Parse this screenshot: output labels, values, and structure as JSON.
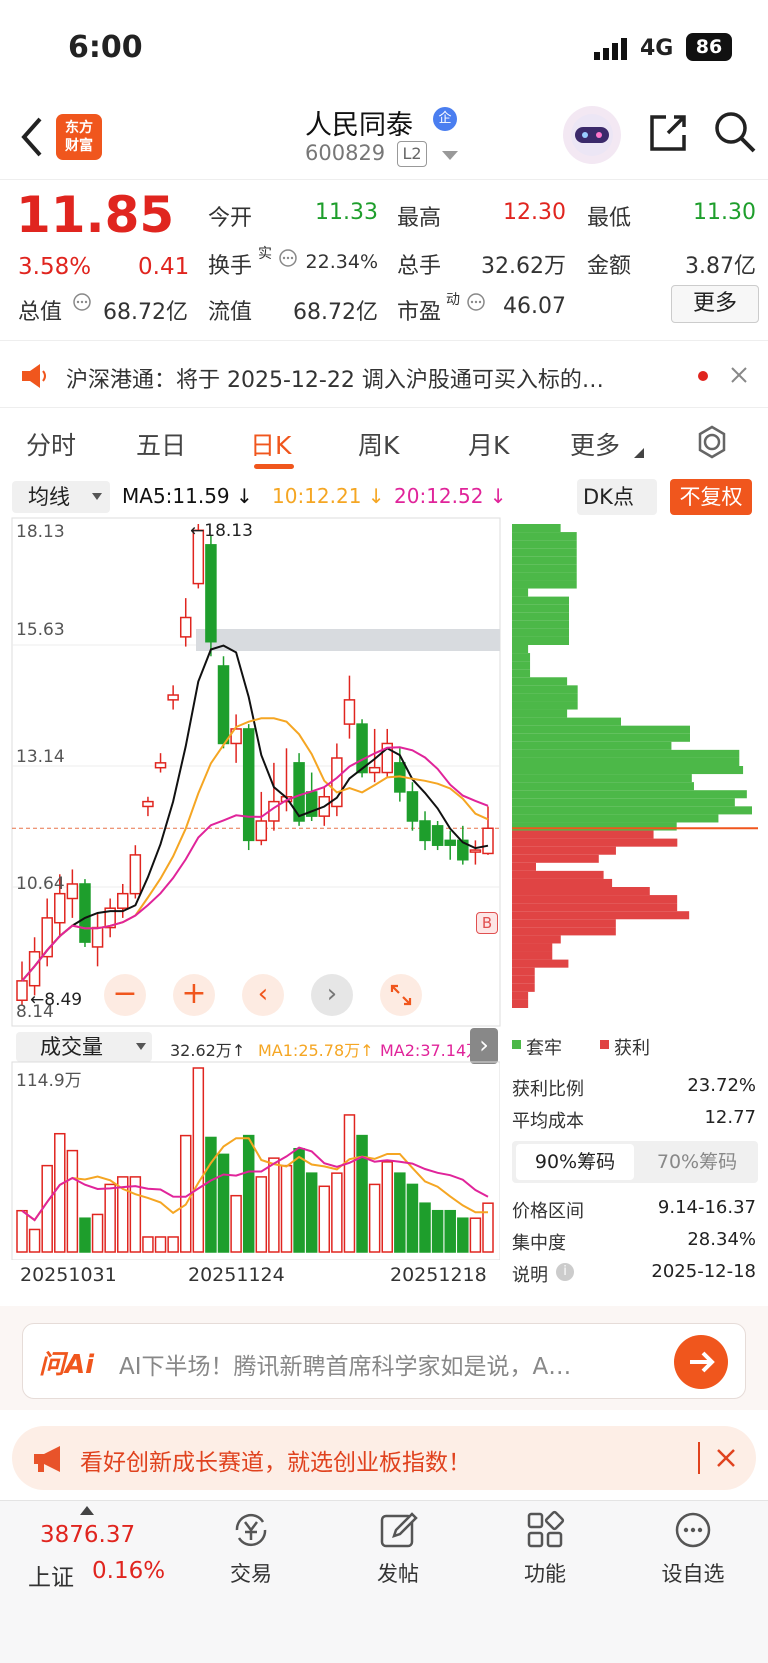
{
  "status_bar": {
    "time": "6:00",
    "network": "4G",
    "battery": "86"
  },
  "header": {
    "logo_text": "东方\n财富",
    "stock_name": "人民同泰",
    "badge": "企",
    "code": "600829",
    "level": "L2"
  },
  "quote": {
    "price": "11.85",
    "change_pct": "3.58%",
    "change_amt": "0.41",
    "open_label": "今开",
    "open": "11.33",
    "high_label": "最高",
    "high": "12.30",
    "low_label": "最低",
    "low": "11.30",
    "turnover_label": "换手",
    "turnover_sup": "实",
    "turnover": "22.34%",
    "volume_label": "总手",
    "volume": "32.62万",
    "amount_label": "金额",
    "amount": "3.87亿",
    "mktcap_label": "总值",
    "mktcap": "68.72亿",
    "float_label": "流值",
    "float": "68.72亿",
    "pe_label": "市盈",
    "pe_sup": "动",
    "pe": "46.07",
    "more_button": "更多"
  },
  "notice": {
    "text": "沪深港通：将于 2025-12-22 调入沪股通可买入标的…"
  },
  "tabs": [
    "分时",
    "五日",
    "日K",
    "周K",
    "月K",
    "更多"
  ],
  "active_tab": "日K",
  "indicators": {
    "ma_select": "均线",
    "ma5": "MA5:11.59",
    "ma10": "10:12.21",
    "ma20": "20:12.52",
    "dk_button": "DK点",
    "fq_button": "不复权"
  },
  "price_axis": {
    "top": "18.13",
    "l2": "15.63",
    "l3": "13.14",
    "l4": "10.64",
    "bottom": "8.14"
  },
  "annotations": {
    "max": "18.13",
    "min": "8.49",
    "buy_marker": "B"
  },
  "volume": {
    "select": "成交量",
    "value": "32.62万",
    "ma1": "MA1:25.78万",
    "ma2": "MA2:37.14万",
    "axis_top": "114.9万"
  },
  "dates": [
    "20251031",
    "20251124",
    "20251218"
  ],
  "chips": {
    "legend_trapped": "套牢",
    "legend_profit": "获利",
    "rows": [
      {
        "label": "获利比例",
        "value": "23.72%"
      },
      {
        "label": "平均成本",
        "value": "12.77"
      }
    ],
    "tab_90": "90%筹码",
    "tab_70": "70%筹码",
    "rows2": [
      {
        "label": "价格区间",
        "value": "9.14-16.37"
      },
      {
        "label": "集中度",
        "value": "28.34%"
      },
      {
        "label": "说明",
        "value": "2025-12-18"
      }
    ]
  },
  "ai_bar": {
    "brand": "问Ai",
    "text": "AI下半场！腾讯新聘首席科学家如是说，A…"
  },
  "promo": {
    "text": "看好创新成长赛道，就选创业板指数！"
  },
  "bottom_nav": {
    "index_value": "3876.37",
    "index_name": "上证",
    "index_change": "0.16%",
    "items": [
      "交易",
      "发帖",
      "功能",
      "设自选"
    ]
  },
  "colors": {
    "accent": "#f0561d",
    "up": "#e0251f",
    "down": "#1e9e2c",
    "ma5": "#111111",
    "ma10": "#f5a623",
    "ma20": "#e0249a"
  },
  "chart_data": {
    "type": "candlestick",
    "title": "",
    "ylim": [
      8.14,
      18.13
    ],
    "candles": [
      {
        "o": 8.3,
        "c": 8.7,
        "h": 9.1,
        "l": 8.2
      },
      {
        "o": 8.6,
        "c": 9.3,
        "h": 9.6,
        "l": 8.4
      },
      {
        "o": 9.2,
        "c": 10.0,
        "h": 10.4,
        "l": 9.0
      },
      {
        "o": 9.9,
        "c": 10.5,
        "h": 10.9,
        "l": 9.6
      },
      {
        "o": 10.4,
        "c": 10.7,
        "h": 11.0,
        "l": 10.0
      },
      {
        "o": 10.7,
        "c": 9.5,
        "h": 10.8,
        "l": 9.4
      },
      {
        "o": 9.4,
        "c": 9.8,
        "h": 10.1,
        "l": 9.0
      },
      {
        "o": 9.8,
        "c": 10.2,
        "h": 10.4,
        "l": 9.6
      },
      {
        "o": 10.2,
        "c": 10.5,
        "h": 10.7,
        "l": 10.0
      },
      {
        "o": 10.5,
        "c": 11.3,
        "h": 11.5,
        "l": 10.4
      },
      {
        "o": 12.3,
        "c": 12.4,
        "h": 12.5,
        "l": 12.1
      },
      {
        "o": 13.1,
        "c": 13.2,
        "h": 13.4,
        "l": 13.0
      },
      {
        "o": 14.5,
        "c": 14.6,
        "h": 14.8,
        "l": 14.3
      },
      {
        "o": 15.8,
        "c": 16.2,
        "h": 16.6,
        "l": 15.6
      },
      {
        "o": 16.9,
        "c": 18.0,
        "h": 18.13,
        "l": 16.8
      },
      {
        "o": 17.7,
        "c": 15.7,
        "h": 17.9,
        "l": 15.4
      },
      {
        "o": 15.2,
        "c": 13.6,
        "h": 15.4,
        "l": 13.5
      },
      {
        "o": 13.6,
        "c": 13.9,
        "h": 14.2,
        "l": 13.2
      },
      {
        "o": 13.9,
        "c": 11.6,
        "h": 14.0,
        "l": 11.4
      },
      {
        "o": 11.6,
        "c": 12.0,
        "h": 12.6,
        "l": 11.5
      },
      {
        "o": 12.0,
        "c": 12.4,
        "h": 13.2,
        "l": 11.8
      },
      {
        "o": 12.4,
        "c": 12.5,
        "h": 13.5,
        "l": 12.2
      },
      {
        "o": 13.2,
        "c": 12.0,
        "h": 13.4,
        "l": 11.9
      },
      {
        "o": 12.6,
        "c": 12.1,
        "h": 13.0,
        "l": 12.0
      },
      {
        "o": 12.1,
        "c": 12.5,
        "h": 12.7,
        "l": 11.9
      },
      {
        "o": 12.3,
        "c": 13.3,
        "h": 13.6,
        "l": 12.1
      },
      {
        "o": 14.0,
        "c": 14.5,
        "h": 15.0,
        "l": 13.7
      },
      {
        "o": 14.0,
        "c": 13.0,
        "h": 14.1,
        "l": 12.9
      },
      {
        "o": 13.0,
        "c": 13.1,
        "h": 13.9,
        "l": 12.8
      },
      {
        "o": 13.0,
        "c": 13.6,
        "h": 13.9,
        "l": 12.9
      },
      {
        "o": 13.2,
        "c": 12.6,
        "h": 13.5,
        "l": 12.4
      },
      {
        "o": 12.6,
        "c": 12.0,
        "h": 12.8,
        "l": 11.8
      },
      {
        "o": 12.0,
        "c": 11.6,
        "h": 12.2,
        "l": 11.4
      },
      {
        "o": 11.9,
        "c": 11.5,
        "h": 12.0,
        "l": 11.4
      },
      {
        "o": 11.6,
        "c": 11.5,
        "h": 11.8,
        "l": 11.2
      },
      {
        "o": 11.6,
        "c": 11.2,
        "h": 11.9,
        "l": 11.1
      },
      {
        "o": 11.4,
        "c": 11.4,
        "h": 11.6,
        "l": 11.1
      },
      {
        "o": 11.33,
        "c": 11.85,
        "h": 12.3,
        "l": 11.3
      }
    ],
    "volumes": [
      22,
      12,
      46,
      63,
      54,
      18,
      20,
      36,
      40,
      40,
      8,
      8,
      8,
      62,
      98,
      61,
      52,
      30,
      62,
      40,
      50,
      46,
      55,
      42,
      35,
      42,
      73,
      62,
      36,
      48,
      42,
      36,
      26,
      22,
      22,
      18,
      18,
      26
    ]
  }
}
